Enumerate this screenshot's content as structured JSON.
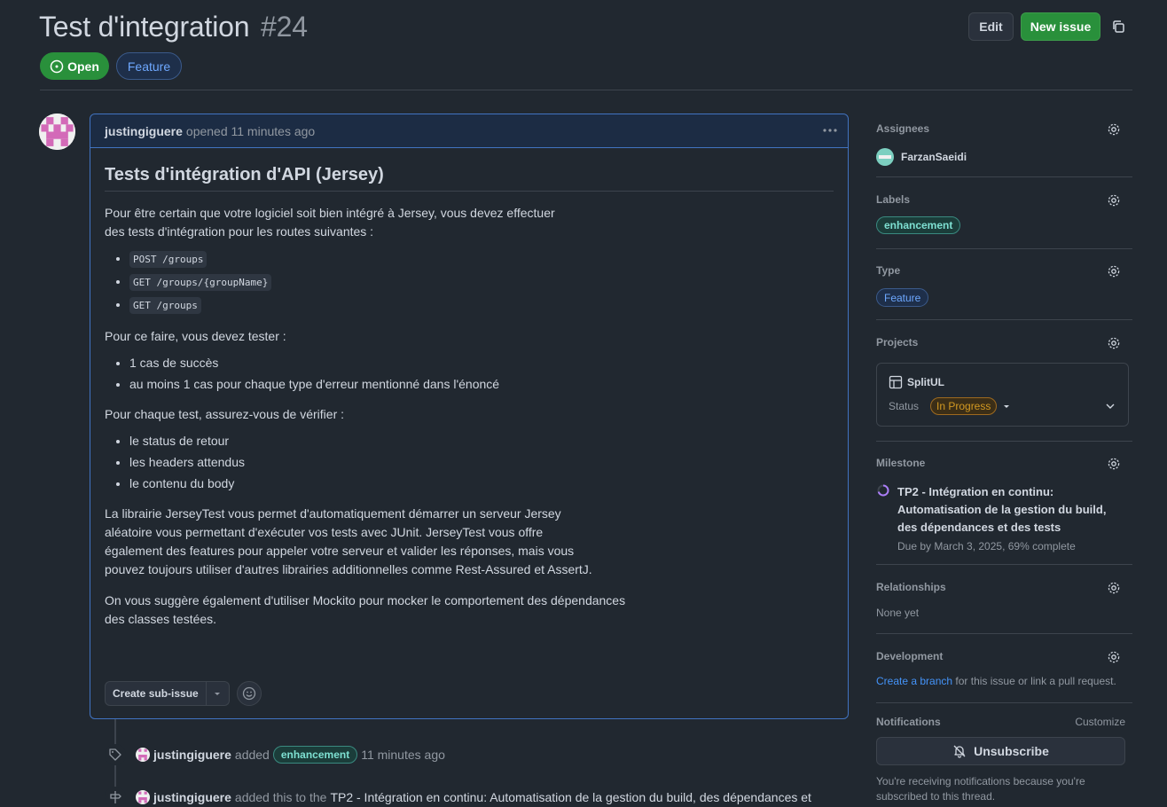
{
  "header": {
    "title": "Test d'integration",
    "number": "#24",
    "edit_label": "Edit",
    "new_issue_label": "New issue",
    "state": "Open",
    "type": "Feature"
  },
  "comment": {
    "author": "justingiguere",
    "meta": "opened 11 minutes ago",
    "heading": "Tests d'intégration d'API (Jersey)",
    "p1_line1": "Pour être certain que votre logiciel soit bien intégré à Jersey, vous devez effectuer",
    "p1_line2": "des tests d'intégration pour les routes suivantes :",
    "routes": [
      "POST /groups",
      "GET /groups/{groupName}",
      "GET /groups"
    ],
    "p2": "Pour ce faire, vous devez tester :",
    "tests": [
      "1 cas de succès",
      "au moins 1 cas pour chaque type d'erreur mentionné dans l'énoncé"
    ],
    "p3": "Pour chaque test, assurez-vous de vérifier :",
    "checks": [
      "le status de retour",
      "les headers attendus",
      "le contenu du body"
    ],
    "p4_lines": [
      "La librairie JerseyTest vous permet d'automatiquement démarrer un serveur Jersey",
      "aléatoire vous permettant d'exécuter vos tests avec JUnit. JerseyTest vous offre",
      "également des features pour appeler votre serveur et valider les réponses, mais vous",
      "pouvez toujours utiliser d'autres librairies additionnelles comme Rest-Assured et AssertJ."
    ],
    "p5_lines": [
      "On vous suggère également d'utiliser Mockito pour mocker le comportement des dépendances",
      "des classes testées."
    ],
    "create_sub_issue_label": "Create sub-issue"
  },
  "timeline": [
    {
      "author": "justingiguere",
      "action": "added",
      "label": "enhancement",
      "time": "11 minutes ago"
    },
    {
      "author": "justingiguere",
      "action": "added this to the",
      "target": "TP2 - Intégration en continu: Automatisation de la gestion du build, des dépendances et"
    }
  ],
  "sidebar": {
    "assignees_title": "Assignees",
    "assignee": "FarzanSaeidi",
    "labels_title": "Labels",
    "label": "enhancement",
    "type_title": "Type",
    "type": "Feature",
    "projects_title": "Projects",
    "project_name": "SplitUL",
    "status_label": "Status",
    "status_value": "In Progress",
    "milestone_title": "Milestone",
    "milestone_line1": "TP2 - Intégration en continu:",
    "milestone_line2": "Automatisation de la gestion du build,",
    "milestone_line3": "des dépendances et des tests",
    "milestone_due": "Due by March 3, 2025, 69% complete",
    "relationships_title": "Relationships",
    "relationships_value": "None yet",
    "development_title": "Development",
    "development_link": "Create a branch",
    "development_rest": " for this issue or link a pull request.",
    "notifications_title": "Notifications",
    "customize_label": "Customize",
    "unsubscribe_label": "Unsubscribe",
    "notif_line1": "You're receiving notifications because you're",
    "notif_line2": "subscribed to this thread."
  },
  "colors": {
    "accent_green": "#29903b",
    "accent_blue": "#4493f8",
    "label_teal": "#7ee0d2",
    "status_orange": "#d29922"
  },
  "icons": [
    "copy-icon",
    "issue-open-icon",
    "kebab-icon",
    "caret-down-icon",
    "smiley-icon",
    "tag-icon",
    "milestone-icon",
    "gear-icon",
    "table-icon",
    "chevron-down-icon",
    "bell-slash-icon",
    "progress-ring-icon"
  ]
}
